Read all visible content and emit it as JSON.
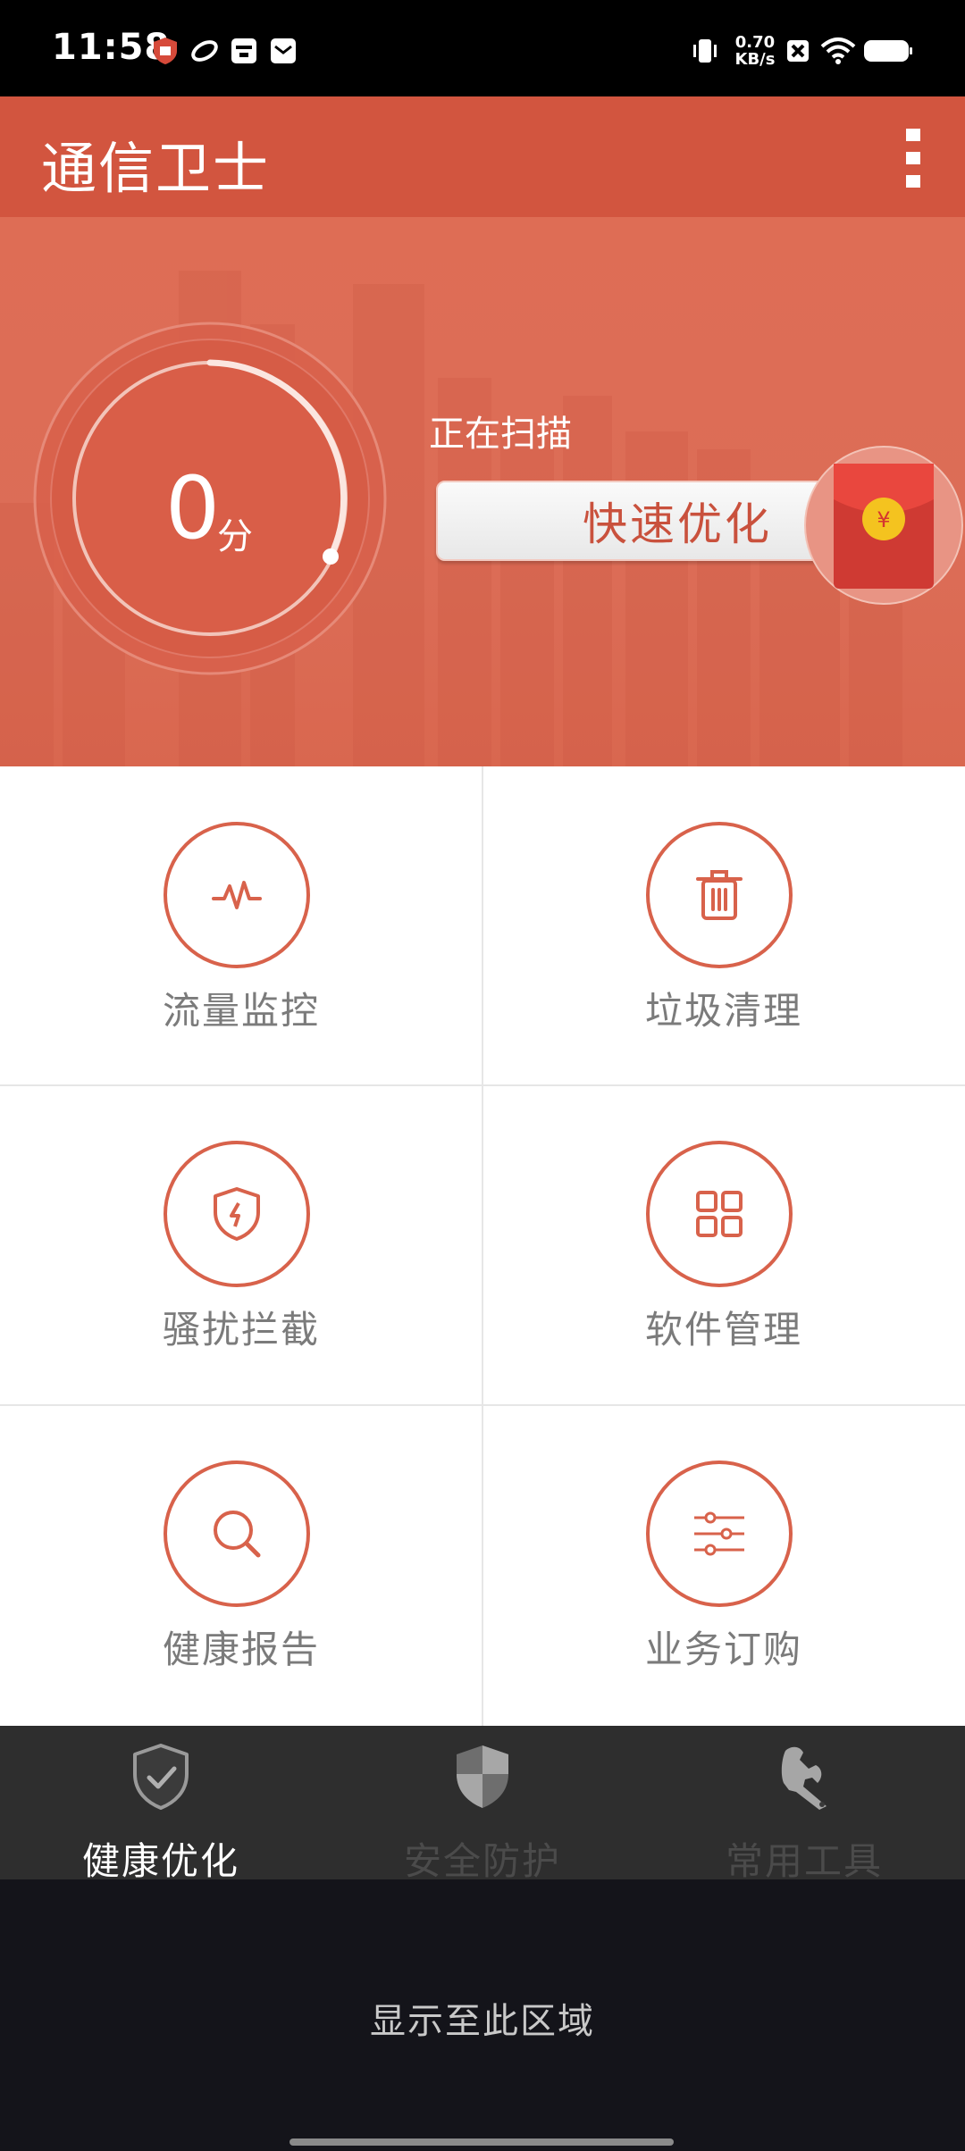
{
  "status_bar": {
    "time": "11:58",
    "net_speed_value": "0.70",
    "net_speed_unit": "KB/s",
    "icons": [
      "shield-app-icon",
      "swirl-app-icon",
      "inbox-icon",
      "mail-icon",
      "vibrate-icon",
      "close-box-icon",
      "wifi-icon",
      "battery-icon"
    ]
  },
  "app_bar": {
    "title": "通信卫士",
    "menu_icon": "more-vert-icon"
  },
  "hero": {
    "score_value": "0",
    "score_unit": "分",
    "scan_status": "正在扫描",
    "optimize_button": "快速优化",
    "red_packet_icon": "red-packet-icon",
    "red_packet_symbol": "¥"
  },
  "features": [
    {
      "label": "流量监控",
      "icon": "pulse-icon"
    },
    {
      "label": "垃圾清理",
      "icon": "trash-icon"
    },
    {
      "label": "骚扰拦截",
      "icon": "shield-bolt-icon"
    },
    {
      "label": "软件管理",
      "icon": "grid-icon"
    },
    {
      "label": "健康报告",
      "icon": "search-icon"
    },
    {
      "label": "业务订购",
      "icon": "sliders-icon"
    }
  ],
  "bottom_nav": [
    {
      "label": "健康优化",
      "icon": "shield-check-icon",
      "active": true
    },
    {
      "label": "安全防护",
      "icon": "shield-half-icon",
      "active": false
    },
    {
      "label": "常用工具",
      "icon": "wrench-icon",
      "active": false
    }
  ],
  "bottom_area": {
    "text": "显示至此区域"
  },
  "colors": {
    "accent": "#d8624b",
    "app_bar": "#d2553f",
    "hero": "#dd6c56",
    "nav_bg": "#2e2e2e",
    "nav_active": "#ffffff",
    "nav_inactive": "#4b4b4b"
  }
}
